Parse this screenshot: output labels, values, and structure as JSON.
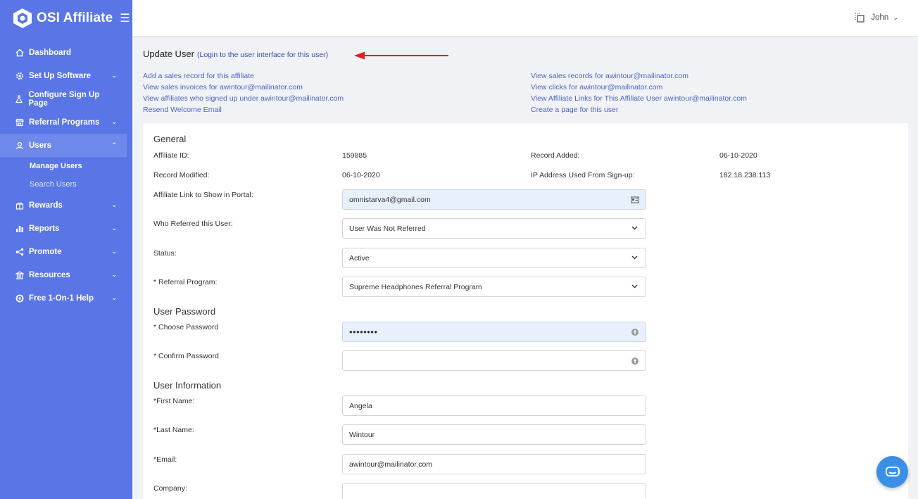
{
  "app": {
    "brand_name": "OSI Affiliate",
    "user_name": "John"
  },
  "sidebar": {
    "items": [
      {
        "label": "Dashboard",
        "icon": "home-icon"
      },
      {
        "label": "Set Up Software",
        "icon": "gear-icon"
      },
      {
        "label": "Configure Sign Up Page",
        "icon": "flask-icon"
      },
      {
        "label": "Referral Programs",
        "icon": "store-icon"
      },
      {
        "label": "Users",
        "icon": "user-icon"
      },
      {
        "label": "Rewards",
        "icon": "gift-icon"
      },
      {
        "label": "Reports",
        "icon": "bar-chart-icon"
      },
      {
        "label": "Promote",
        "icon": "share-icon"
      },
      {
        "label": "Resources",
        "icon": "bank-icon"
      },
      {
        "label": "Free 1-On-1 Help",
        "icon": "lifebuoy-icon"
      }
    ],
    "users_sub": [
      "Manage Users",
      "Search Users"
    ]
  },
  "page": {
    "title": "Update User",
    "login_link": "(Login to the user interface for this user)",
    "links_left": [
      "Add a sales record for this affiliate",
      "View sales invoices for awintour@mailinator.com",
      "View affiliates who signed up under awintour@mailinator.com",
      "Resend Welcome Email"
    ],
    "links_right": [
      "View sales records for awintour@mailinator.com",
      "View clicks for awintour@mailinator.com",
      "View Affiliate Links for This Affiliate User awintour@mailinator.com",
      "Create a page for this user"
    ]
  },
  "general": {
    "title": "General",
    "affiliate_id_label": "Affiliate ID:",
    "affiliate_id": "159885",
    "record_added_label": "Record Added:",
    "record_added": "06-10-2020",
    "record_modified_label": "Record Modified:",
    "record_modified": "06-10-2020",
    "ip_label": "IP Address Used From Sign-up:",
    "ip": "182.18.238.113",
    "affiliate_link_label": "Affiliate Link to Show in Portal:",
    "affiliate_link_value": "omnistarva4@gmail.com",
    "referred_label": "Who Referred this User:",
    "referred_value": "User Was Not Referred",
    "status_label": "Status:",
    "status_value": "Active",
    "program_label": "* Referral Program:",
    "program_value": "Supreme Headphones Referral Program"
  },
  "password": {
    "title": "User Password",
    "choose_label": "* Choose Password",
    "choose_value": "••••••••",
    "confirm_label": "* Confirm Password",
    "confirm_value": ""
  },
  "info": {
    "title": "User Information",
    "first_label": "*First Name:",
    "first_value": "Angela",
    "last_label": "*Last Name:",
    "last_value": "Wintour",
    "email_label": "*Email:",
    "email_value": "awintour@mailinator.com",
    "company_label": "Company:",
    "company_value": ""
  },
  "colors": {
    "sidebar": "#5a76e6",
    "accent_link": "#4a66c4",
    "autofill": "#e8f0fe",
    "arrow": "#e02020",
    "chat": "#3b8fe6"
  }
}
